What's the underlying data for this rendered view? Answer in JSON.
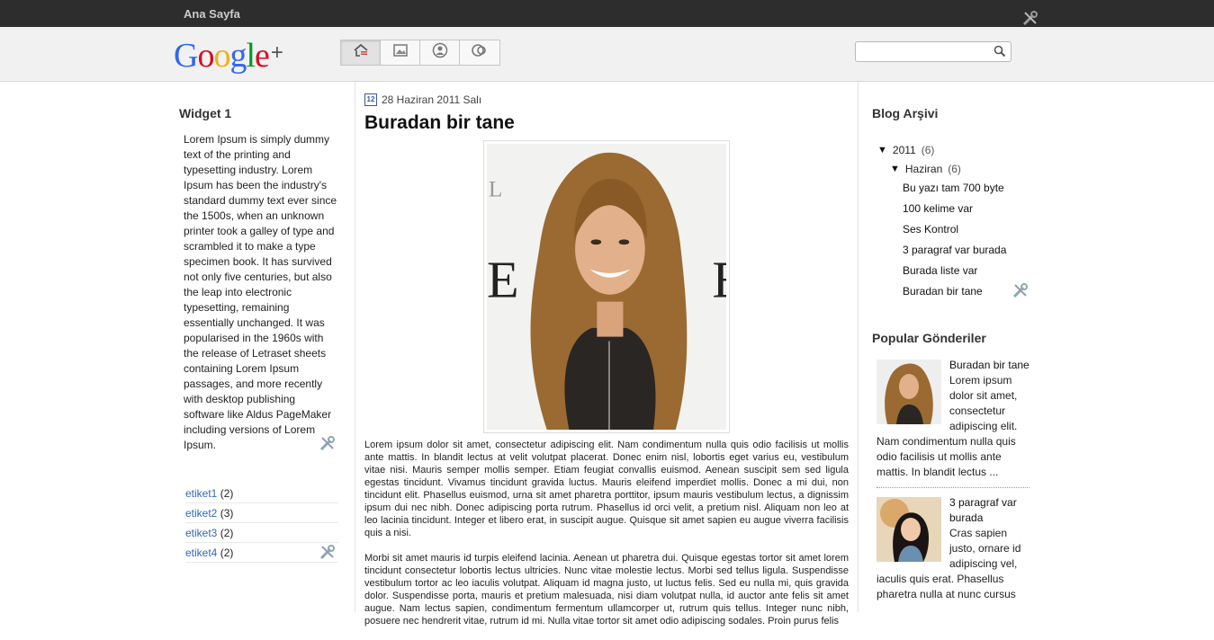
{
  "topbar": {
    "home_label": "Ana Sayfa"
  },
  "header": {
    "logo_text": "Google",
    "logo_plus": "+",
    "tabs": [
      "home",
      "photos",
      "profile",
      "circles"
    ],
    "search": {
      "placeholder": "",
      "value": ""
    }
  },
  "left": {
    "widget_title": "Widget 1",
    "widget_text": "Lorem Ipsum is simply dummy text of the printing and typesetting industry. Lorem Ipsum has been the industry's standard dummy text ever since the 1500s, when an unknown printer took a galley of type and scrambled it to make a type specimen book. It has survived not only five centuries, but also the leap into electronic typesetting, remaining essentially unchanged. It was popularised in the 1960s with the release of Letraset sheets containing Lorem Ipsum passages, and more recently with desktop publishing software like Aldus PageMaker including versions of Lorem Ipsum.",
    "labels": [
      {
        "name": "etiket1",
        "count": "(2)"
      },
      {
        "name": "etiket2",
        "count": "(3)"
      },
      {
        "name": "etiket3",
        "count": "(2)"
      },
      {
        "name": "etiket4",
        "count": "(2)"
      }
    ]
  },
  "post": {
    "date": "28 Haziran 2011 Salı",
    "calendar_day": "12",
    "title": "Buradan bir tane",
    "paragraphs": [
      "Lorem ipsum dolor sit amet, consectetur adipiscing elit. Nam condimentum nulla quis odio facilisis ut mollis ante mattis. In blandit lectus at velit volutpat placerat. Donec enim nisl, lobortis eget varius eu, vestibulum vitae nisi. Mauris semper mollis semper. Etiam feugiat convallis euismod. Aenean suscipit sem sed ligula egestas tincidunt. Vivamus tincidunt gravida luctus. Mauris eleifend imperdiet mollis. Donec a mi dui, non tincidunt elit. Phasellus euismod, urna sit amet pharetra porttitor, ipsum mauris vestibulum lectus, a dignissim ipsum dui nec nibh. Donec adipiscing porta rutrum. Phasellus id orci velit, a pretium nisl. Aliquam non leo at leo lacinia tincidunt. Integer et libero erat, in suscipit augue. Quisque sit amet sapien eu augue viverra facilisis quis a nisi.",
      "Morbi sit amet mauris id turpis eleifend lacinia. Aenean ut pharetra dui. Quisque egestas tortor sit amet lorem tincidunt consectetur lobortis lectus ultricies. Nunc vitae molestie lectus. Morbi sed tellus ligula. Suspendisse vestibulum tortor ac leo iaculis volutpat. Aliquam id magna justo, ut luctus felis. Sed eu nulla mi, quis gravida dolor. Suspendisse porta, mauris et pretium malesuada, nisi diam volutpat nulla, id auctor ante felis sit amet augue. Nam lectus sapien, condimentum fermentum ullamcorper ut, rutrum quis tellus. Integer nunc nibh, posuere nec hendrerit vitae, rutrum id mi. Nulla vitae tortor sit amet odio adipiscing sodales. Proin purus felis"
    ]
  },
  "right": {
    "archive_title": "Blog Arşivi",
    "year": {
      "label": "2011",
      "count": "(6)"
    },
    "month": {
      "label": "Haziran",
      "count": "(6)"
    },
    "posts": [
      "Bu yazı tam 700 byte",
      "100 kelime var",
      "Ses Kontrol",
      "3 paragraf var burada",
      "Burada liste var",
      "Buradan bir tane"
    ],
    "popular_title": "Popular Gönderiler",
    "popular": [
      {
        "title": "Buradan bir tane",
        "snippet": "Lorem ipsum dolor sit amet, consectetur adipiscing elit. Nam condimentum nulla quis odio facilisis ut mollis ante mattis. In blandit lectus ..."
      },
      {
        "title": "3 paragraf var burada",
        "snippet": "Cras sapien justo, ornare id adipiscing vel, iaculis quis erat. Phasellus pharetra nulla at nunc cursus"
      }
    ]
  },
  "colors": {
    "topbar": "#2d2d2d",
    "header_bg": "#f1f1f1",
    "link": "#3366bb"
  }
}
